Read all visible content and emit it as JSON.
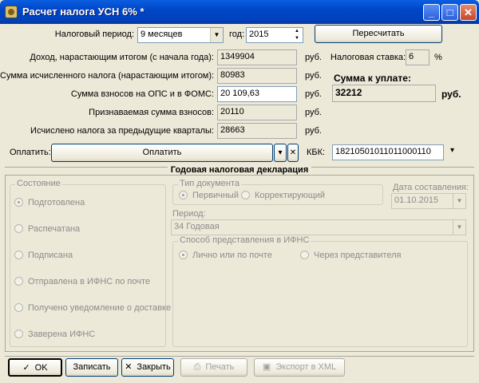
{
  "window": {
    "title": "Расчет налога УСН 6% *"
  },
  "header": {
    "period_label": "Налоговый период:",
    "period_value": "9 месяцев",
    "year_label": "год:",
    "year_value": "2015",
    "recalc_label": "Пересчитать"
  },
  "rows": [
    {
      "label": "Доход, нарастающим итогом (с начала года):",
      "value": "1349904",
      "unit": "руб."
    },
    {
      "label": "Сумма исчисленного налога (нарастающим итогом):",
      "value": "80983",
      "unit": "руб."
    },
    {
      "label": "Сумма взносов на ОПС и в ФОМС:",
      "value": "20 109,63",
      "unit": "руб."
    },
    {
      "label": "Признаваемая сумма взносов:",
      "value": "20110",
      "unit": "руб."
    },
    {
      "label": "Исчислено налога за предыдущие кварталы:",
      "value": "28663",
      "unit": "руб."
    }
  ],
  "rate": {
    "label": "Налоговая ставка:",
    "value": "6",
    "unit": "%"
  },
  "topay": {
    "label": "Сумма к уплате:",
    "value": "32212",
    "unit": "руб."
  },
  "payment": {
    "label": "Оплатить:",
    "button_label": "Оплатить",
    "kbk_label": "КБК:",
    "kbk_value": "18210501011011000110"
  },
  "declaration": {
    "title": "Годовая налоговая декларация",
    "state_caption": "Состояние",
    "states": [
      "Подготовлена",
      "Распечатана",
      "Подписана",
      "Отправлена в ИФНС по почте",
      "Получено уведомление о доставке",
      "Заверена ИФНС"
    ],
    "doc_type_caption": "Тип документа",
    "doc_types": [
      "Первичный",
      "Корректирующий"
    ],
    "date_label": "Дата составления:",
    "date_value": "01.10.2015",
    "period_label": "Период:",
    "period_value": "34 Годовая",
    "method_caption": "Способ представления в ИФНС",
    "methods": [
      "Лично или по почте",
      "Через представителя"
    ]
  },
  "footer": {
    "ok": "OK",
    "save": "Записать",
    "close": "Закрыть",
    "print": "Печать",
    "export": "Экспорт в XML"
  }
}
